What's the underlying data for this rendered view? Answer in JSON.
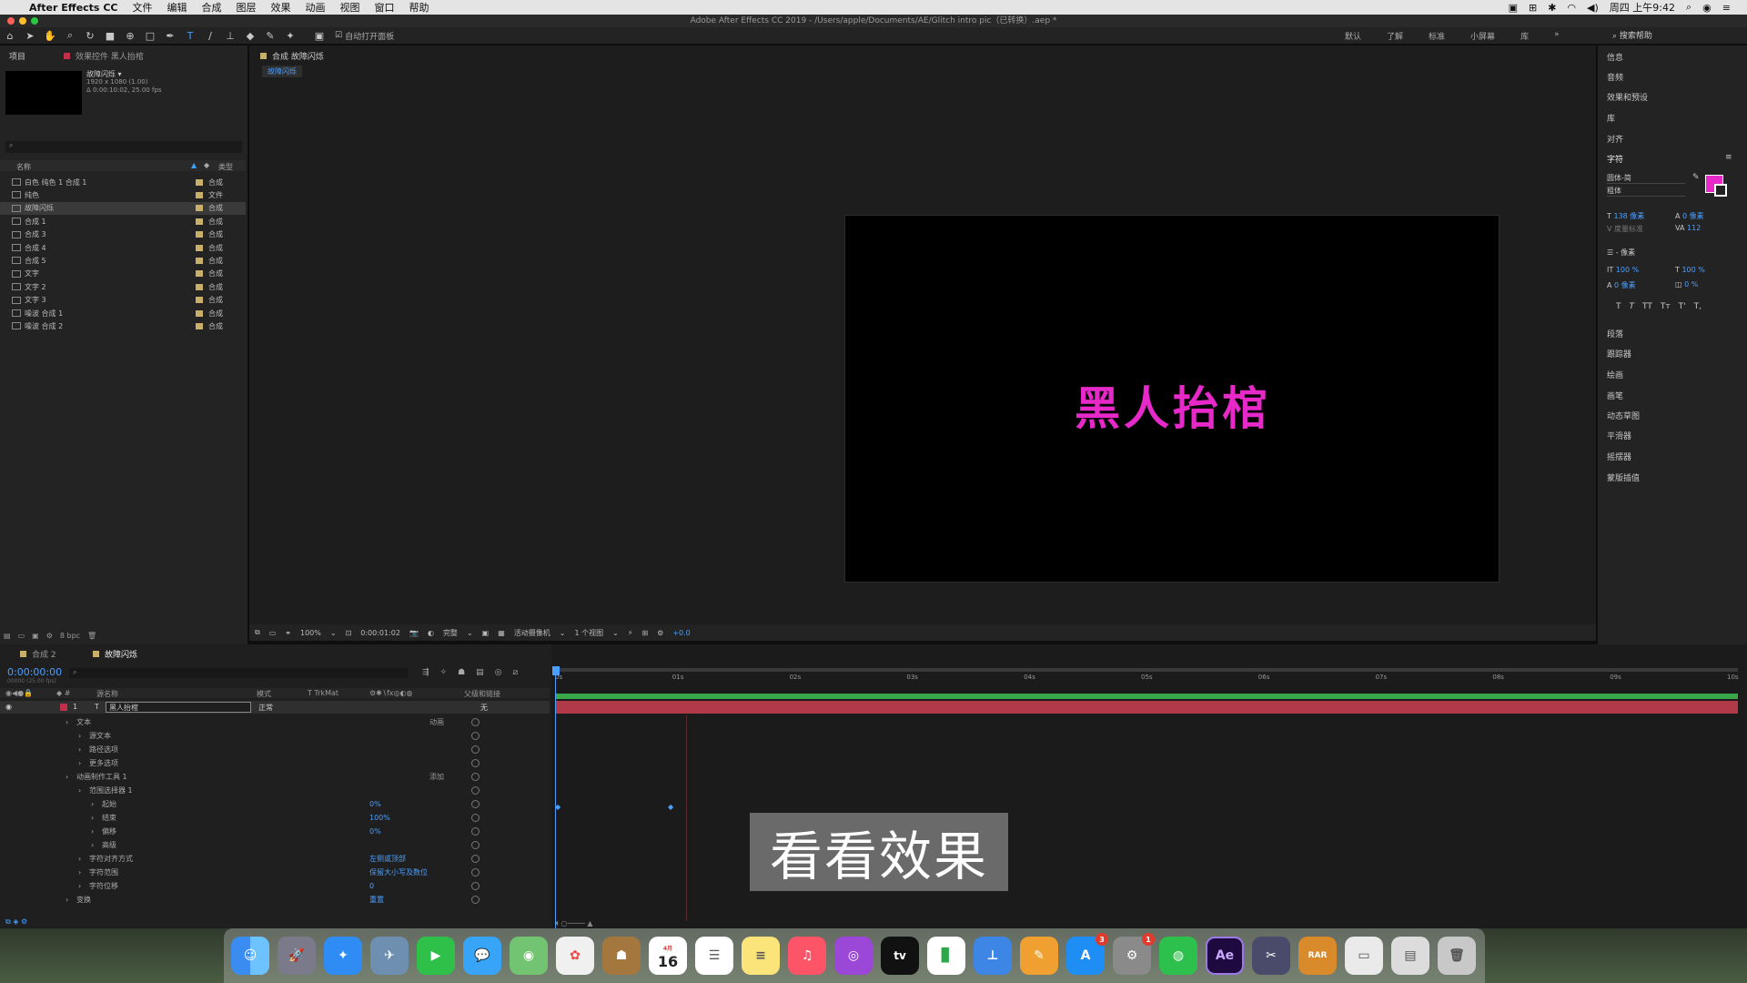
{
  "menubar": {
    "app": "After Effects CC",
    "items": [
      "文件",
      "编辑",
      "合成",
      "图层",
      "效果",
      "动画",
      "视图",
      "窗口",
      "帮助"
    ],
    "clock": "周四 上午9:42"
  },
  "window": {
    "title": "Adobe After Effects CC 2019 - /Users/apple/Documents/AE/Glitch intro pic（已转换）.aep *"
  },
  "toolbar": {
    "auto_open": "自动打开面板",
    "workspaces": [
      "默认",
      "了解",
      "标准",
      "小屏幕",
      "库"
    ],
    "search_placeholder": "搜索帮助"
  },
  "project": {
    "tab": "项目",
    "effects_tab": "效果控件 黑人抬棺",
    "selected_name": "故障闪烁 ▾",
    "selected_info1": "1920 x 1080 (1.00)",
    "selected_info2": "Δ 0:00:10:02, 25.00 fps",
    "col_name": "名称",
    "col_type": "类型",
    "bpc": "8 bpc",
    "items": [
      {
        "name": "白色 纯色 1 合成 1",
        "type": "合成"
      },
      {
        "name": "纯色",
        "type": "文件"
      },
      {
        "name": "故障闪烁",
        "type": "合成"
      },
      {
        "name": "合成 1",
        "type": "合成"
      },
      {
        "name": "合成 3",
        "type": "合成"
      },
      {
        "name": "合成 4",
        "type": "合成"
      },
      {
        "name": "合成 5",
        "type": "合成"
      },
      {
        "name": "文字",
        "type": "合成"
      },
      {
        "name": "文字 2",
        "type": "合成"
      },
      {
        "name": "文字 3",
        "type": "合成"
      },
      {
        "name": "噪波 合成 1",
        "type": "合成"
      },
      {
        "name": "噪波 合成 2",
        "type": "合成"
      }
    ]
  },
  "viewer": {
    "tab": "合成 故障闪烁",
    "subtab": "故障闪烁",
    "canvas_text": "黑人抬棺",
    "canvas_text_color": "#e629c8",
    "zoom": "100%",
    "time": "0:00:01:02",
    "quality": "完整",
    "camera": "活动摄像机",
    "views": "1 个视图",
    "exposure": "+0.0"
  },
  "right": {
    "panels_top": [
      "信息",
      "音频",
      "效果和预设",
      "库",
      "对齐"
    ],
    "character": {
      "title": "字符",
      "font": "圆体-简",
      "style": "粗体",
      "size": "138 像素",
      "tracking_top": "0 像素",
      "leading": "度量标准",
      "kerning": "112",
      "stroke": "- 像素",
      "vscale": "100 %",
      "hscale": "100 %",
      "baseline": "0 像素",
      "tsume": "0 %",
      "fill_color": "#e629c8"
    },
    "panels_bottom": [
      "段落",
      "跟踪器",
      "绘画",
      "画笔",
      "动态草图",
      "平滑器",
      "摇摆器",
      "蒙版插值"
    ]
  },
  "timeline": {
    "tabs": [
      "合成 2",
      "故障闪烁"
    ],
    "timecode": "0:00:00:00",
    "fps_note": "00000 (25.00 fps)",
    "cols": [
      "源名称",
      "模式",
      "T TrkMat",
      "父级和链接"
    ],
    "layer": {
      "num": "1",
      "name": "黑人抬棺",
      "mode": "正常",
      "parent": "无"
    },
    "rows": [
      {
        "name": "文本",
        "indent": 1,
        "right": "动画"
      },
      {
        "name": "源文本",
        "indent": 2
      },
      {
        "name": "路径选项",
        "indent": 2
      },
      {
        "name": "更多选项",
        "indent": 2
      },
      {
        "name": "动画制作工具 1",
        "indent": 1,
        "right": "添加"
      },
      {
        "name": "范围选择器 1",
        "indent": 2
      },
      {
        "name": "起始",
        "indent": 3,
        "value": "0%"
      },
      {
        "name": "结束",
        "indent": 3,
        "value": "100%"
      },
      {
        "name": "偏移",
        "indent": 3,
        "value": "0%"
      },
      {
        "name": "高级",
        "indent": 3
      },
      {
        "name": "字符对齐方式",
        "indent": 2,
        "value": "左侧或顶部"
      },
      {
        "name": "字符范围",
        "indent": 2,
        "value": "保留大小写及数位"
      },
      {
        "name": "字符位移",
        "indent": 2,
        "value": "0"
      },
      {
        "name": "变换",
        "indent": 1,
        "value": "重置"
      }
    ],
    "ruler": [
      "0s",
      "01s",
      "02s",
      "03s",
      "04s",
      "05s",
      "06s",
      "07s",
      "08s",
      "09s",
      "10s"
    ],
    "layer_bar_color": "#b03a48"
  },
  "subtitle": "看看效果",
  "dock": {
    "apps": [
      "Finder",
      "Launchpad",
      "Safari",
      "Preview",
      "FaceTime",
      "Messages",
      "Maps",
      "Photos",
      "Contacts",
      "Calendar",
      "Reminders",
      "Notes",
      "Music",
      "Podcasts",
      "TV",
      "Numbers",
      "Keynote",
      "Pages",
      "App Store",
      "System Preferences",
      "WeChat",
      "Ae",
      "Final Cut",
      "RAR",
      "Screenshot",
      "Preview2",
      "Trash"
    ],
    "calendar_day": "16",
    "calendar_month": "4月",
    "appstore_badge": "3",
    "sysprefs_badge": "1",
    "tv_label": "tv",
    "ae_label": "Ae",
    "rar_label": "RAR"
  }
}
